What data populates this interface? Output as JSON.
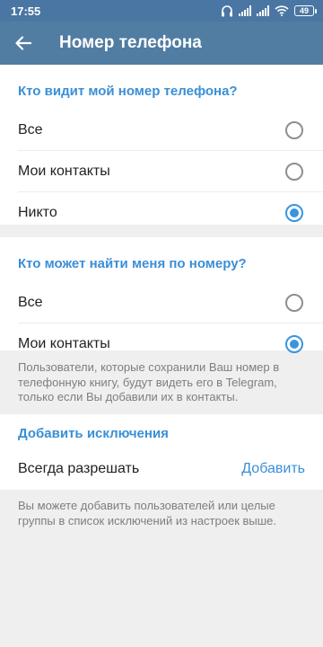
{
  "status_bar": {
    "time": "17:55",
    "battery": "49",
    "icons": [
      "headphones-icon",
      "signal-icon",
      "signal-icon",
      "wifi-icon",
      "battery-icon"
    ]
  },
  "app_bar": {
    "title": "Номер телефона",
    "back_icon": "arrow-back-icon"
  },
  "who_sees": {
    "header": "Кто видит мой номер телефона?",
    "options": [
      {
        "label": "Все",
        "checked": false
      },
      {
        "label": "Мои контакты",
        "checked": false
      },
      {
        "label": "Никто",
        "checked": true
      }
    ]
  },
  "who_finds": {
    "header": "Кто может найти меня по номеру?",
    "options": [
      {
        "label": "Все",
        "checked": false
      },
      {
        "label": "Мои контакты",
        "checked": true
      }
    ],
    "info": "Пользователи, которые сохранили Ваш номер в телефонную книгу, будут видеть его в Telegram, только если Вы добавили их в контакты."
  },
  "exceptions": {
    "header": "Добавить исключения",
    "always_allow_label": "Всегда разрешать",
    "add_label": "Добавить",
    "info": "Вы можете добавить пользователей или целые группы в список исключений из настроек выше."
  },
  "colors": {
    "status_bar": "#4a76a3",
    "app_bar": "#517da2",
    "accent": "#3a8fd6",
    "background": "#efeff0"
  }
}
